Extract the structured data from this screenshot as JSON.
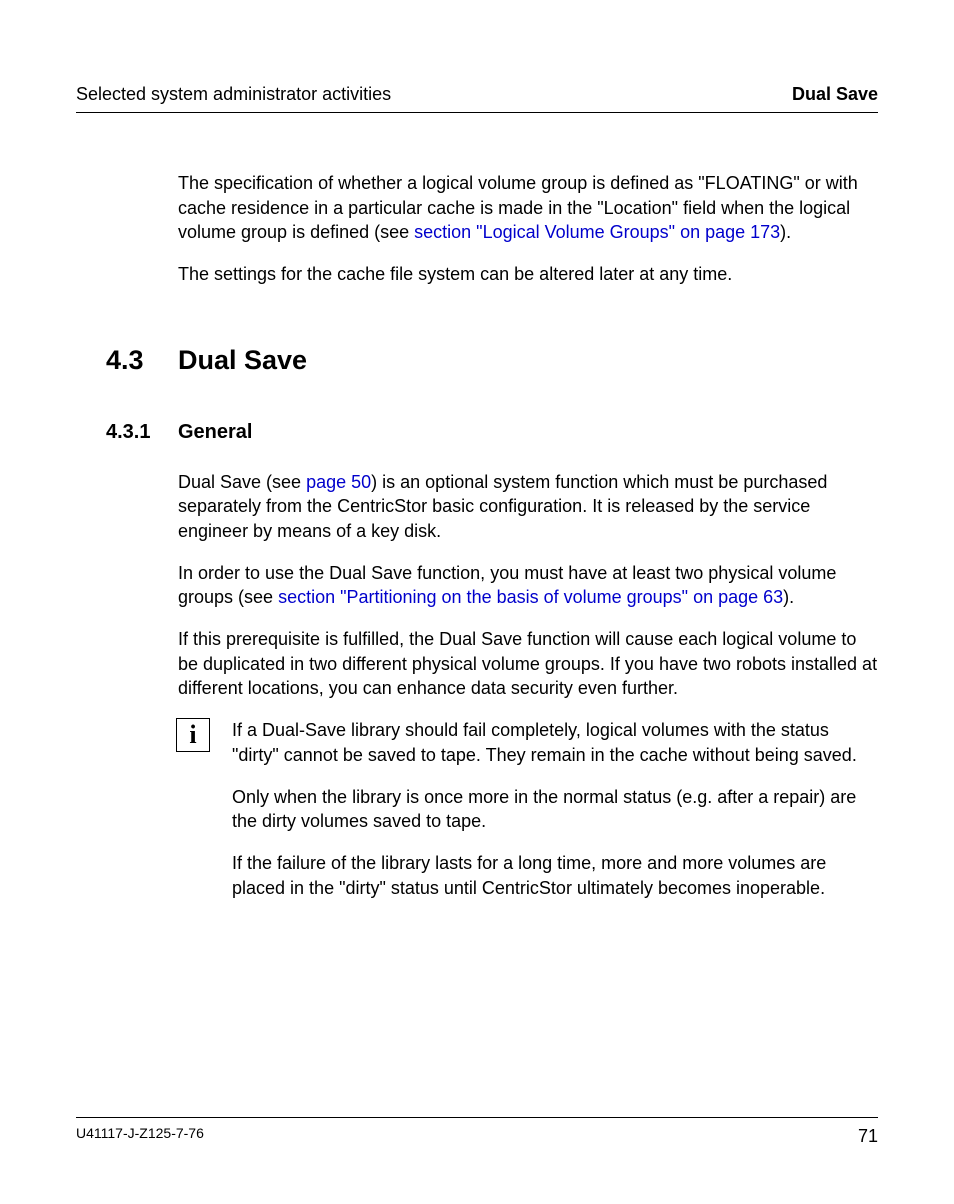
{
  "header": {
    "left": "Selected system administrator activities",
    "right": "Dual Save"
  },
  "intro": {
    "p1a": "The specification of whether a logical volume group is defined as \"FLOATING\" or with cache residence in a particular cache is made in the \"Location\" field when the logical volume group is defined (see ",
    "p1link": "section \"Logical Volume Groups\" on page 173",
    "p1b": ").",
    "p2": "The settings for the cache file system can be altered later at any time."
  },
  "section": {
    "num": "4.3",
    "title": "Dual Save"
  },
  "subsection": {
    "num": "4.3.1",
    "title": "General"
  },
  "body": {
    "p1a": "Dual Save (see ",
    "p1link": "page 50",
    "p1b": ") is an optional system function which must be purchased separately from the CentricStor basic configuration. It is released by the service engineer by means of a key disk.",
    "p2a": "In order to use the Dual Save function, you must have at least two physical volume groups (see ",
    "p2link": "section \"Partitioning on the basis of volume groups\" on page 63",
    "p2b": ").",
    "p3": "If this prerequisite is fulfilled, the Dual Save function will cause each logical volume to be duplicated in two different physical volume groups. If you have two robots installed at different locations, you can enhance data security even further."
  },
  "note": {
    "glyph": "i",
    "p1": "If a Dual-Save library should fail completely, logical volumes with the status \"dirty\" cannot be saved to tape. They remain in the cache without being saved.",
    "p2": "Only when the library is once more in the normal status (e.g. after a repair) are the dirty volumes saved to tape.",
    "p3": "If the failure of the library lasts for a long time, more and more volumes are placed in the \"dirty\" status until CentricStor ultimately becomes inoperable."
  },
  "footer": {
    "doc": "U41117-J-Z125-7-76",
    "page": "71"
  }
}
